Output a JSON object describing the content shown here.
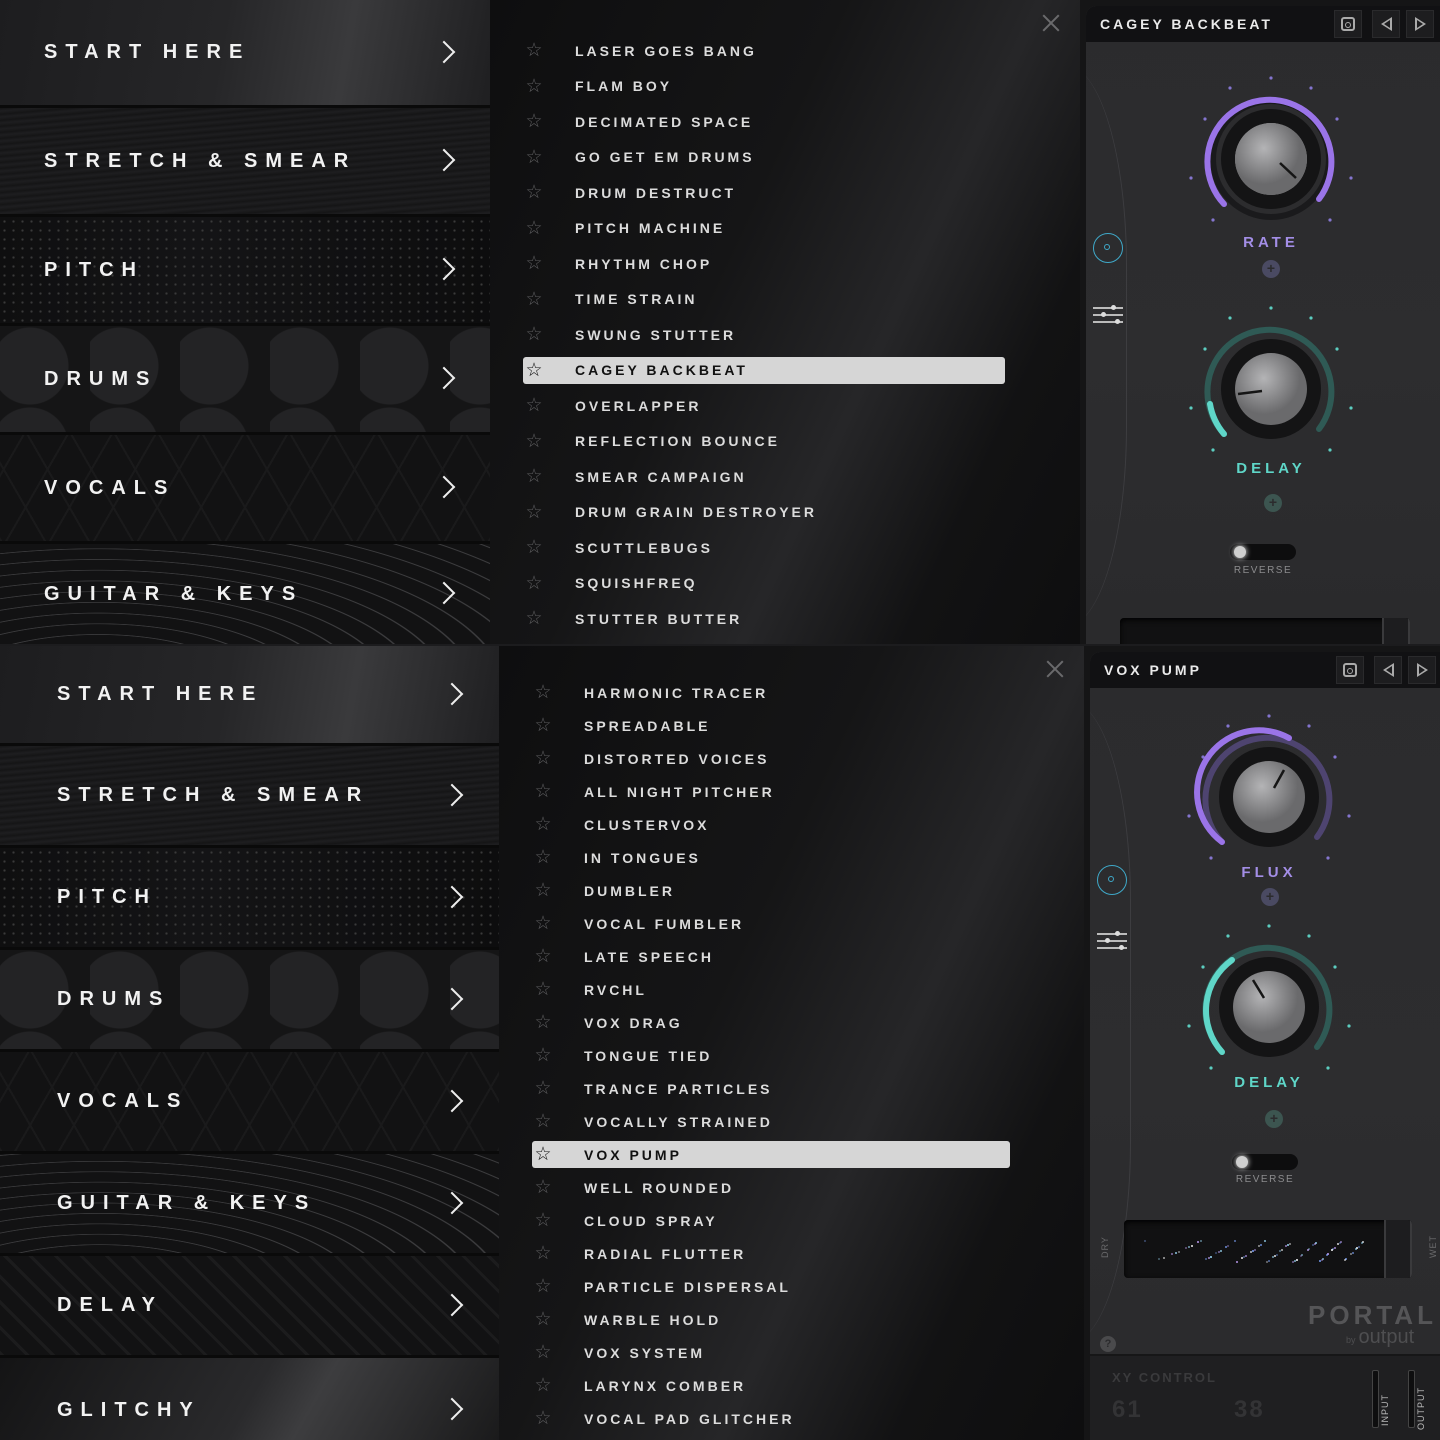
{
  "panels": [
    {
      "categories": [
        "START HERE",
        "STRETCH & SMEAR",
        "PITCH",
        "DRUMS",
        "VOCALS",
        "GUITAR & KEYS"
      ],
      "presets": [
        "LASER GOES BANG",
        "FLAM BOY",
        "DECIMATED SPACE",
        "GO GET EM DRUMS",
        "DRUM DESTRUCT",
        "PITCH MACHINE",
        "RHYTHM CHOP",
        "TIME STRAIN",
        "SWUNG STUTTER",
        "CAGEY BACKBEAT",
        "OVERLAPPER",
        "REFLECTION BOUNCE",
        "SMEAR CAMPAIGN",
        "DRUM GRAIN DESTROYER",
        "SCUTTLEBUGS",
        "SQUISHFREQ",
        "STUTTER BUTTER"
      ],
      "selected_preset": "CAGEY BACKBEAT",
      "editor": {
        "title": "CAGEY BACKBEAT",
        "knob1_label": "RATE",
        "knob2_label": "DELAY",
        "toggle_label": "REVERSE"
      }
    },
    {
      "categories": [
        "START HERE",
        "STRETCH & SMEAR",
        "PITCH",
        "DRUMS",
        "VOCALS",
        "GUITAR & KEYS",
        "DELAY",
        "GLITCHY"
      ],
      "presets": [
        "HARMONIC TRACER",
        "SPREADABLE",
        "DISTORTED VOICES",
        "ALL NIGHT PITCHER",
        "CLUSTERVOX",
        "IN TONGUES",
        "DUMBLER",
        "VOCAL FUMBLER",
        "LATE SPEECH",
        "RVCHL",
        "VOX DRAG",
        "TONGUE TIED",
        "TRANCE PARTICLES",
        "VOCALLY STRAINED",
        "VOX PUMP",
        "WELL ROUNDED",
        "CLOUD SPRAY",
        "RADIAL FLUTTER",
        "PARTICLE DISPERSAL",
        "WARBLE HOLD",
        "VOX SYSTEM",
        "LARYNX COMBER",
        "VOCAL PAD GLITCHER"
      ],
      "selected_preset": "VOX PUMP",
      "editor": {
        "title": "VOX PUMP",
        "knob1_label": "FLUX",
        "knob2_label": "DELAY",
        "toggle_label": "REVERSE",
        "xy_left_label": "DRY",
        "xy_right_label": "WET",
        "brand": "PORTAL",
        "brand_by": "by",
        "brand_company": "output",
        "help": "?",
        "xy_control_title": "XY CONTROL",
        "xy_x_value": "61",
        "xy_y_value": "38",
        "input_label": "INPUT",
        "output_label": "OUTPUT"
      }
    }
  ],
  "icons": {
    "star": "☆",
    "star_selected": "☆",
    "plus": "+"
  },
  "colors": {
    "purple_accent": "#9a74e8",
    "teal_accent": "#5fd6c8",
    "selection_bg": "#d6d6d6",
    "target_icon": "#3fa8c8"
  }
}
